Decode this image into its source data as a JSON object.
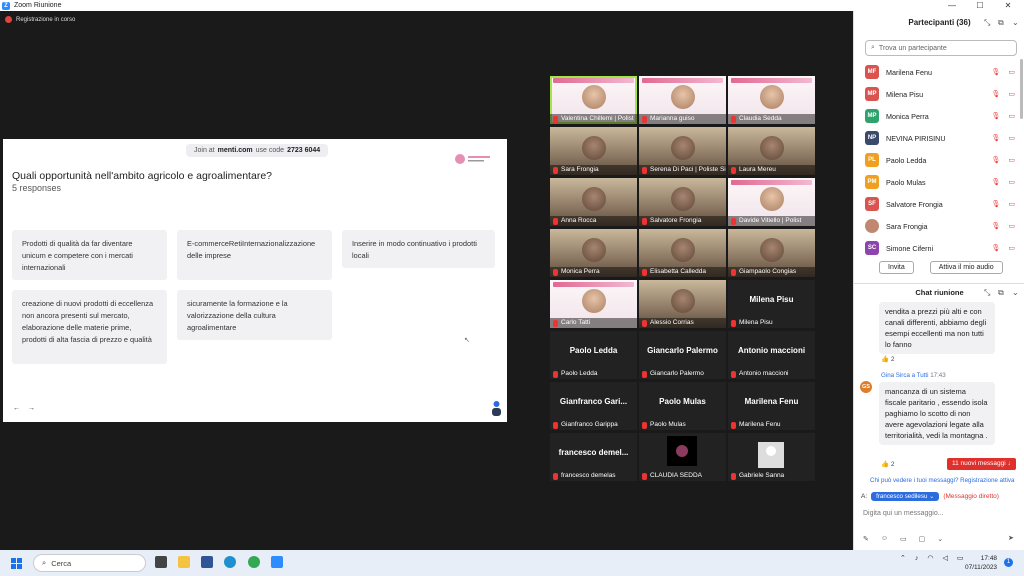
{
  "window": {
    "title": "Zoom Riunione",
    "min": "—",
    "max": "☐",
    "close": "✕"
  },
  "recording": {
    "label": "Registrazione in corso"
  },
  "share": {
    "join_prefix": "Join at",
    "join_site": "menti.com",
    "join_mid": "use code",
    "join_code": "2723 6044",
    "question": "Quali opportunità nell'ambito agricolo e agroalimentare?",
    "responses": "5 responses",
    "cards": [
      "Prodotti di qualità da far diventare unicum e competere con i mercati internazionali",
      "E-commerceRetiInternazionalizzazione delle imprese",
      "Inserire in modo continuativo i prodotti locali",
      "creazione di nuovi prodotti di eccellenza non ancora presenti sul mercato, elaborazione delle materie prime, prodotti di alta fascia di prezzo e qualità",
      "sicuramente la formazione e la valorizzazione della cultura agroalimentare"
    ],
    "nav_prev": "←",
    "nav_next": "→"
  },
  "tiles": [
    {
      "name": "Valentina Chillemi | Polist",
      "kind": "slide"
    },
    {
      "name": "Marianna guiso",
      "kind": "slide"
    },
    {
      "name": "Claudia Sedda",
      "kind": "slide"
    },
    {
      "name": "Sara Frongia",
      "kind": "video"
    },
    {
      "name": "Serena Di Paci | Poliste Si",
      "kind": "video"
    },
    {
      "name": "Laura Mereu",
      "kind": "video"
    },
    {
      "name": "Anna Rocca",
      "kind": "video"
    },
    {
      "name": "Salvatore Frongia",
      "kind": "video"
    },
    {
      "name": "Davide Vitiello | Polist",
      "kind": "slide"
    },
    {
      "name": "Monica Perra",
      "kind": "video"
    },
    {
      "name": "Elisabetta Calledda",
      "kind": "video"
    },
    {
      "name": "Giampaolo Congias",
      "kind": "video"
    },
    {
      "name": "Carlo Tatti",
      "kind": "slide"
    },
    {
      "name": "Alessio Corrias",
      "kind": "video"
    },
    {
      "name": "Milena Pisu",
      "kind": "name"
    },
    {
      "name": "Paolo Ledda",
      "kind": "name"
    },
    {
      "name": "Giancarlo Palermo",
      "kind": "name"
    },
    {
      "name": "Antonio maccioni",
      "kind": "name"
    },
    {
      "name": "Gianfranco Garippa",
      "big": "Gianfranco  Gari...",
      "kind": "name"
    },
    {
      "name": "Paolo Mulas",
      "kind": "name"
    },
    {
      "name": "Marilena Fenu",
      "kind": "name"
    },
    {
      "name": "francesco demelas",
      "big": "francesco  demel...",
      "kind": "name"
    },
    {
      "name": "CLAUDIA SEDDA",
      "kind": "avatar"
    },
    {
      "name": "Gabriele Sanna",
      "kind": "photo"
    }
  ],
  "participants": {
    "title": "Partecipanti (36)",
    "search_placeholder": "Trova un partecipante",
    "list": [
      {
        "initials": "MF",
        "name": "Marilena Fenu",
        "color": "#d9534f"
      },
      {
        "initials": "MP",
        "name": "Milena Pisu",
        "color": "#d9534f"
      },
      {
        "initials": "MP",
        "name": "Monica Perra",
        "color": "#2fa36b"
      },
      {
        "initials": "NP",
        "name": "NEVINA PIRISINU",
        "color": "#3a4a6b"
      },
      {
        "initials": "PL",
        "name": "Paolo Ledda",
        "color": "#f0a020"
      },
      {
        "initials": "PM",
        "name": "Paolo Mulas",
        "color": "#f0a020"
      },
      {
        "initials": "SF",
        "name": "Salvatore Frongia",
        "color": "#d9534f"
      },
      {
        "initials": "",
        "name": "Sara Frongia",
        "color": "#c08870"
      },
      {
        "initials": "SC",
        "name": "Simone Ciferni",
        "color": "#8e44ad"
      }
    ],
    "invite": "Invita",
    "unmute_all": "Attiva il mio audio"
  },
  "chat": {
    "title": "Chat riunione",
    "msg1": "vendita a prezzi più alti e con canali differenti, abbiamo degli esempi eccellenti ma non tutti lo fanno",
    "react1": "👍 2",
    "sender": "Gina Sirca a Tutti",
    "time": "17:43",
    "gs_initials": "GS",
    "msg2": "mancanza di un sistema fiscale paritario , essendo isola paghiamo lo scotto di non avere agevolazioni legate alla territorialità, vedi la montagna .",
    "react2": "👍 2",
    "new_messages": "11 nuovi messaggi ↓",
    "info": "Chi può vedere i tuoi messaggi? Registrazione attiva",
    "to_label": "A:",
    "to_select": "francesco sedilesu ⌄",
    "to_dm": "(Messaggio diretto)",
    "input_placeholder": "Digita qui un messaggio..."
  },
  "taskbar": {
    "search": "Cerca",
    "time": "17:48",
    "date": "07/11/2023",
    "notif": "1"
  }
}
